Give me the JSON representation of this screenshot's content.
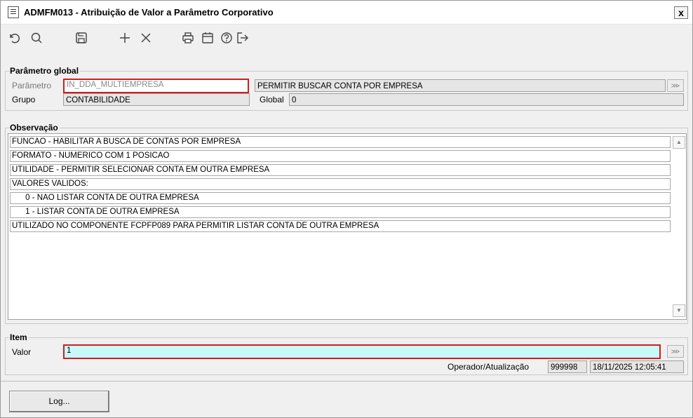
{
  "window": {
    "title": "ADMFM013 - Atribuição de Valor a Parâmetro Corporativo",
    "close_label": "x"
  },
  "toolbar": [
    "undo-icon",
    "search-icon",
    "save-icon",
    "add-icon",
    "delete-icon",
    "print-icon",
    "calendar-icon",
    "help-icon",
    "exit-icon"
  ],
  "parametro_global": {
    "legend": "Parâmetro global",
    "parametro_label": "Parâmetro",
    "parametro_value": "IN_DDA_MULTIEMPRESA",
    "descricao": "PERMITIR  BUSCAR CONTA POR EMPRESA",
    "grupo_label": "Grupo",
    "grupo_value": "CONTABILIDADE",
    "global_label": "Global",
    "global_value": "0"
  },
  "observacao": {
    "legend": "Observação",
    "lines": [
      "FUNCAO - HABILITAR A BUSCA DE CONTAS POR EMPRESA",
      "FORMATO - NUMERICO COM 1 POSICAO",
      "UTILIDADE - PERMITIR SELECIONAR CONTA EM OUTRA EMPRESA",
      "VALORES VALIDOS:",
      "      0 - NAO LISTAR CONTA DE OUTRA EMPRESA",
      "      1 - LISTAR CONTA DE OUTRA EMPRESA",
      "UTILIZADO NO COMPONENTE FCPFP089 PARA PERMITIR LISTAR CONTA DE OUTRA EMPRESA"
    ]
  },
  "item": {
    "legend": "Item",
    "valor_label": "Valor",
    "valor_value": "1",
    "operador_label": "Operador/Atualização",
    "operador_value": "999998",
    "atualizacao_value": "18/11/2025 12:05:41"
  },
  "log_button": "Log..."
}
